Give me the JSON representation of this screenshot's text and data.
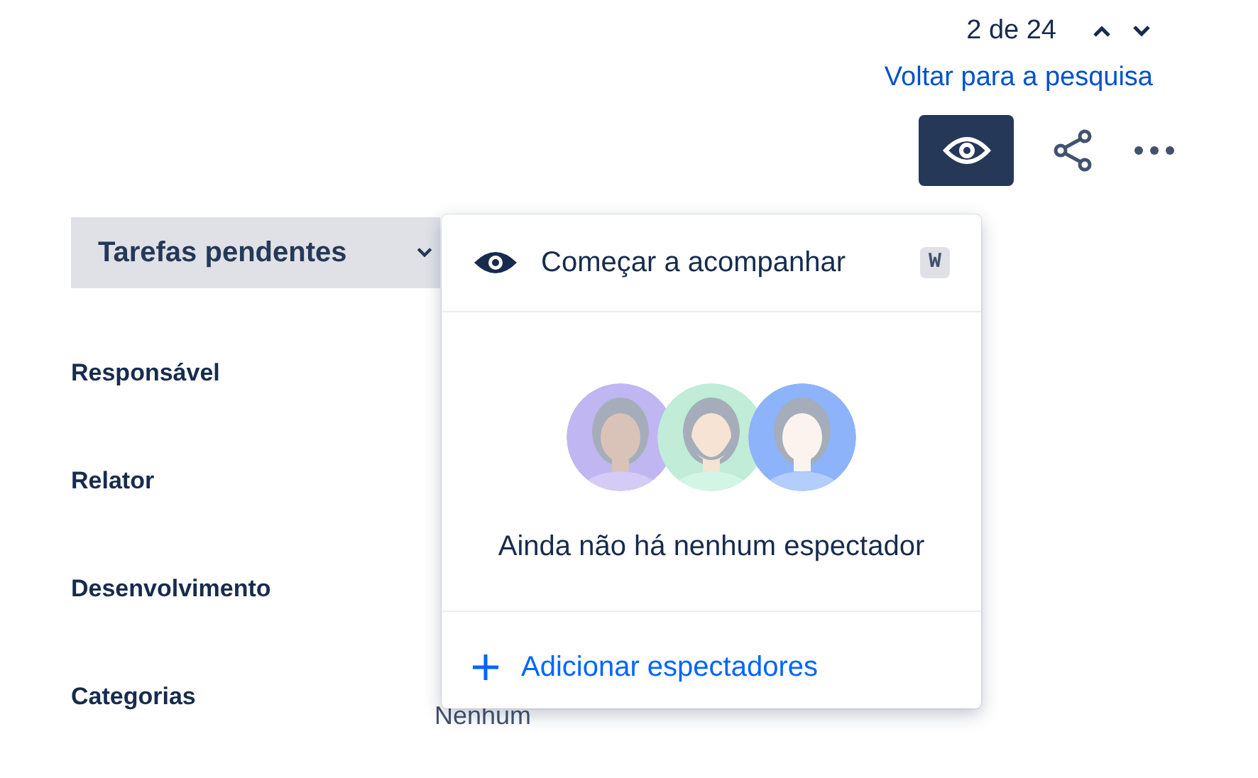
{
  "pager": {
    "position": "2 de 24",
    "back_link": "Voltar para a pesquisa"
  },
  "watch_button": {
    "selected": true
  },
  "status": {
    "label": "Tarefas pendentes"
  },
  "fields": [
    {
      "label": "Responsável"
    },
    {
      "label": "Relator"
    },
    {
      "label": "Desenvolvimento"
    },
    {
      "label": "Categorias",
      "value": "Nenhum"
    }
  ],
  "watch_popup": {
    "action": "Começar a acompanhar",
    "shortcut": "W",
    "empty_message": "Ainda não há nenhum espectador",
    "add_link": "Adicionar espectadores"
  }
}
